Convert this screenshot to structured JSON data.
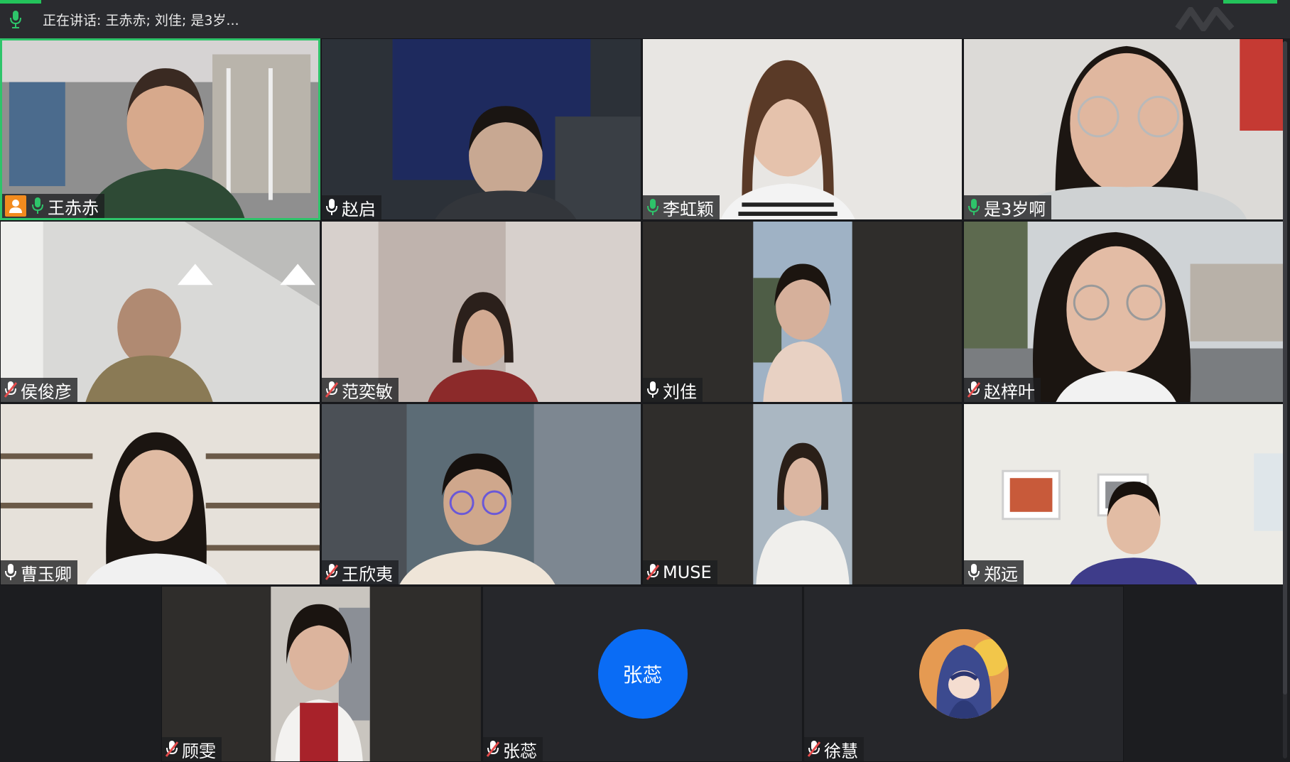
{
  "header": {
    "speaking_text": "正在讲话: 王赤赤; 刘佳; 是3岁...",
    "accent_color": "#23c35b"
  },
  "participants": [
    {
      "name": "王赤赤",
      "mic": "on",
      "host": true,
      "active": true
    },
    {
      "name": "赵启",
      "mic": "on"
    },
    {
      "name": "李虹颖",
      "mic": "on"
    },
    {
      "name": "是3岁啊",
      "mic": "on"
    },
    {
      "name": "侯俊彦",
      "mic": "muted"
    },
    {
      "name": "范奕敏",
      "mic": "muted"
    },
    {
      "name": "刘佳",
      "mic": "on"
    },
    {
      "name": "赵梓叶",
      "mic": "muted"
    },
    {
      "name": "曹玉卿",
      "mic": "on"
    },
    {
      "name": "王欣夷",
      "mic": "muted"
    },
    {
      "name": "MUSE",
      "mic": "muted"
    },
    {
      "name": "郑远",
      "mic": "on"
    },
    {
      "name": "顾雯",
      "mic": "muted"
    },
    {
      "name": "张蕊",
      "mic": "muted",
      "avatar_text": "张蕊",
      "avatar_color": "#0a6cf5"
    },
    {
      "name": "徐慧",
      "mic": "muted",
      "avatar": "illustrated-avatar"
    }
  ],
  "colors": {
    "mic_on": "#2ec46a",
    "mic_muted": "#e44b4b",
    "host_badge": "#f28b1e",
    "active_border": "#2ec46a"
  }
}
